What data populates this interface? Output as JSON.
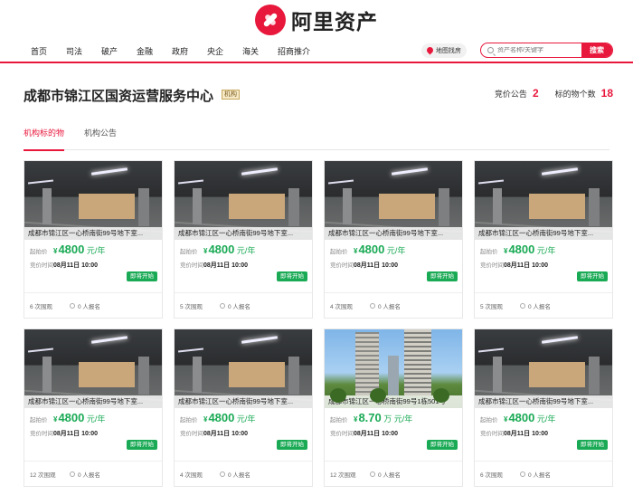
{
  "header": {
    "brand": "阿里资产"
  },
  "nav": {
    "items": [
      "首页",
      "司法",
      "破产",
      "金融",
      "政府",
      "央企",
      "海关",
      "招商推介"
    ],
    "map_search": "地图找房",
    "search_placeholder": "资产名称/关键字",
    "search_button": "搜索"
  },
  "org": {
    "name": "成都市锦江区国资运营服务中心",
    "badge": "机构",
    "stats": [
      {
        "label": "竞价公告",
        "value": "2"
      },
      {
        "label": "标的物个数",
        "value": "18"
      }
    ]
  },
  "tabs": [
    "机构标的物",
    "机构公告"
  ],
  "card_labels": {
    "start_price": "起拍价",
    "bid_time": "竞价时间",
    "viewers_suffix": "次围观",
    "signup_suffix": "人报名",
    "currency": "¥"
  },
  "items": [
    {
      "image": "garage",
      "title": "成都市锦江区一心桥南街99号地下室...",
      "price": "4800",
      "unit": "元/年",
      "time": "08月11日 10:00",
      "status": "即将开始",
      "views": "6",
      "signups": "0"
    },
    {
      "image": "garage",
      "title": "成都市锦江区一心桥南街99号地下室...",
      "price": "4800",
      "unit": "元/年",
      "time": "08月11日 10:00",
      "status": "即将开始",
      "views": "5",
      "signups": "0"
    },
    {
      "image": "garage",
      "title": "成都市锦江区一心桥南街99号地下室...",
      "price": "4800",
      "unit": "元/年",
      "time": "08月11日 10:00",
      "status": "即将开始",
      "views": "4",
      "signups": "0"
    },
    {
      "image": "garage",
      "title": "成都市锦江区一心桥南街99号地下室...",
      "price": "4800",
      "unit": "元/年",
      "time": "08月11日 10:00",
      "status": "即将开始",
      "views": "5",
      "signups": "0"
    },
    {
      "image": "garage",
      "title": "成都市锦江区一心桥南街99号地下室...",
      "price": "4800",
      "unit": "元/年",
      "time": "08月11日 10:00",
      "status": "即将开始",
      "views": "12",
      "signups": "0"
    },
    {
      "image": "garage",
      "title": "成都市锦江区一心桥南街99号地下室...",
      "price": "4800",
      "unit": "元/年",
      "time": "08月11日 10:00",
      "status": "即将开始",
      "views": "4",
      "signups": "0"
    },
    {
      "image": "building",
      "title": "成都市锦江区一心桥南街99号1栋501号",
      "price": "8.70",
      "unit": "万 元/年",
      "time": "08月11日 10:00",
      "status": "即将开始",
      "views": "12",
      "signups": "0"
    },
    {
      "image": "garage",
      "title": "成都市锦江区一心桥南街99号地下室...",
      "price": "4800",
      "unit": "元/年",
      "time": "08月11日 10:00",
      "status": "即将开始",
      "views": "6",
      "signups": "0"
    }
  ]
}
